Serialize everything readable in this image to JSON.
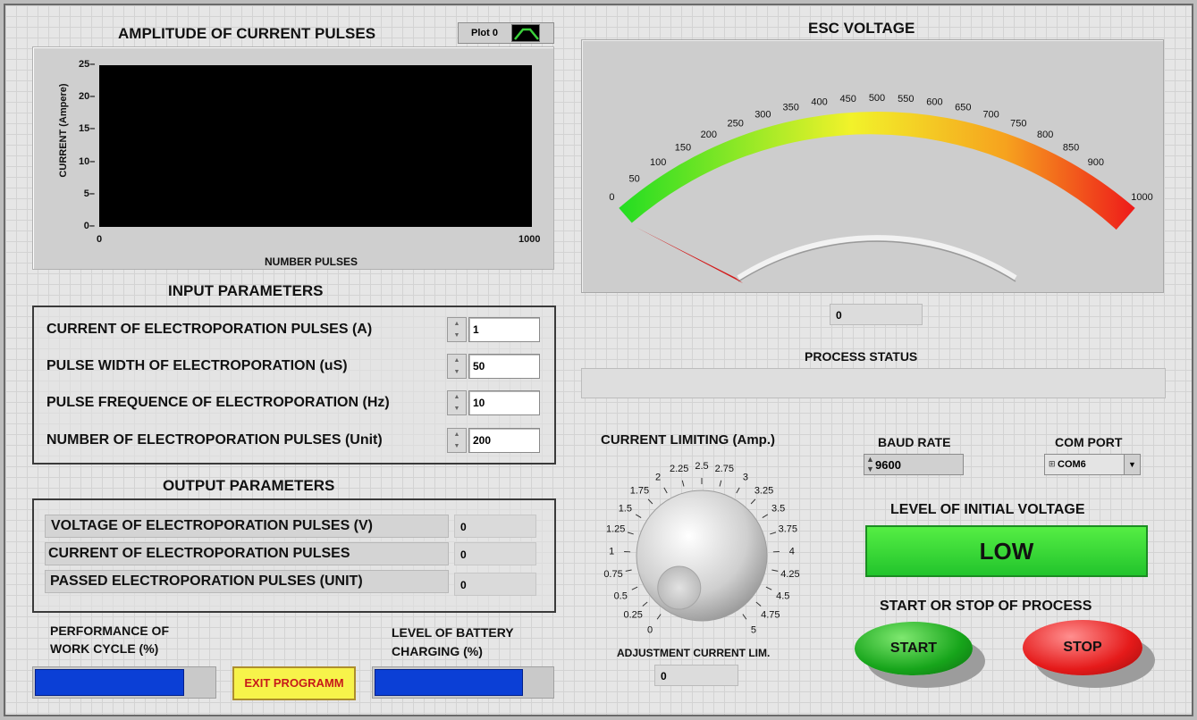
{
  "graph": {
    "title": "AMPLITUDE OF CURRENT PULSES",
    "legend_label": "Plot 0",
    "y_axis_label": "CURRENT (Ampere)",
    "x_axis_label": "NUMBER PULSES",
    "y_ticks": [
      "25",
      "20",
      "15",
      "10",
      "5",
      "0"
    ],
    "x_ticks": [
      "0",
      "1000"
    ]
  },
  "input_parameters": {
    "title": "INPUT PARAMETERS",
    "rows": [
      {
        "label": "CURRENT OF ELECTROPORATION PULSES (A)",
        "value": "1"
      },
      {
        "label": "PULSE WIDTH OF ELECTROPORATION (uS)",
        "value": "50"
      },
      {
        "label": "PULSE FREQUENCE OF ELECTROPORATION (Hz)",
        "value": "10"
      },
      {
        "label": "NUMBER OF ELECTROPORATION PULSES (Unit)",
        "value": "200"
      }
    ]
  },
  "output_parameters": {
    "title": "OUTPUT PARAMETERS",
    "rows": [
      {
        "label": "VOLTAGE OF ELECTROPORATION PULSES (V)",
        "value": "0"
      },
      {
        "label": "CURRENT OF ELECTROPORATION PULSES",
        "value": "0"
      },
      {
        "label": "PASSED ELECTROPORATION PULSES (UNIT)",
        "value": "0"
      }
    ]
  },
  "performance": {
    "label_line1": "PERFORMANCE OF",
    "label_line2": "WORK CYCLE (%)",
    "level": 0.84
  },
  "battery": {
    "label_line1": "LEVEL OF BATTERY",
    "label_line2": "CHARGING (%)",
    "level": 0.84
  },
  "exit_button": {
    "label": "EXIT PROGRAMM"
  },
  "esc_voltage": {
    "title": "ESC VOLTAGE",
    "scale": [
      "0",
      "50",
      "100",
      "150",
      "200",
      "250",
      "300",
      "350",
      "400",
      "450",
      "500",
      "550",
      "600",
      "650",
      "700",
      "750",
      "800",
      "850",
      "900",
      "1000"
    ],
    "value_display": "0",
    "needle_value": 0,
    "colors": {
      "low": "#22dd22",
      "mid": "#f2f22a",
      "high": "#ee1a1a"
    }
  },
  "process_status": {
    "title": "PROCESS STATUS",
    "text": ""
  },
  "current_limiting": {
    "title": "CURRENT LIMITING (Amp.)",
    "scale": [
      "0",
      "0.25",
      "0.5",
      "0.75",
      "1",
      "1.25",
      "1.5",
      "1.75",
      "2",
      "2.25",
      "2.5",
      "2.75",
      "3",
      "3.25",
      "3.5",
      "3.75",
      "4",
      "4.25",
      "4.5",
      "4.75",
      "5"
    ],
    "knob_label": "ADJUSTMENT CURRENT LIM.",
    "value_display": "0"
  },
  "baud_rate": {
    "label": "BAUD RATE",
    "value": "9600"
  },
  "com_port": {
    "label": "COM PORT",
    "value": "COM6"
  },
  "initial_voltage": {
    "title": "LEVEL OF INITIAL VOLTAGE",
    "state": "LOW"
  },
  "process_control": {
    "title": "START OR STOP OF PROCESS",
    "start_label": "START",
    "stop_label": "STOP"
  }
}
